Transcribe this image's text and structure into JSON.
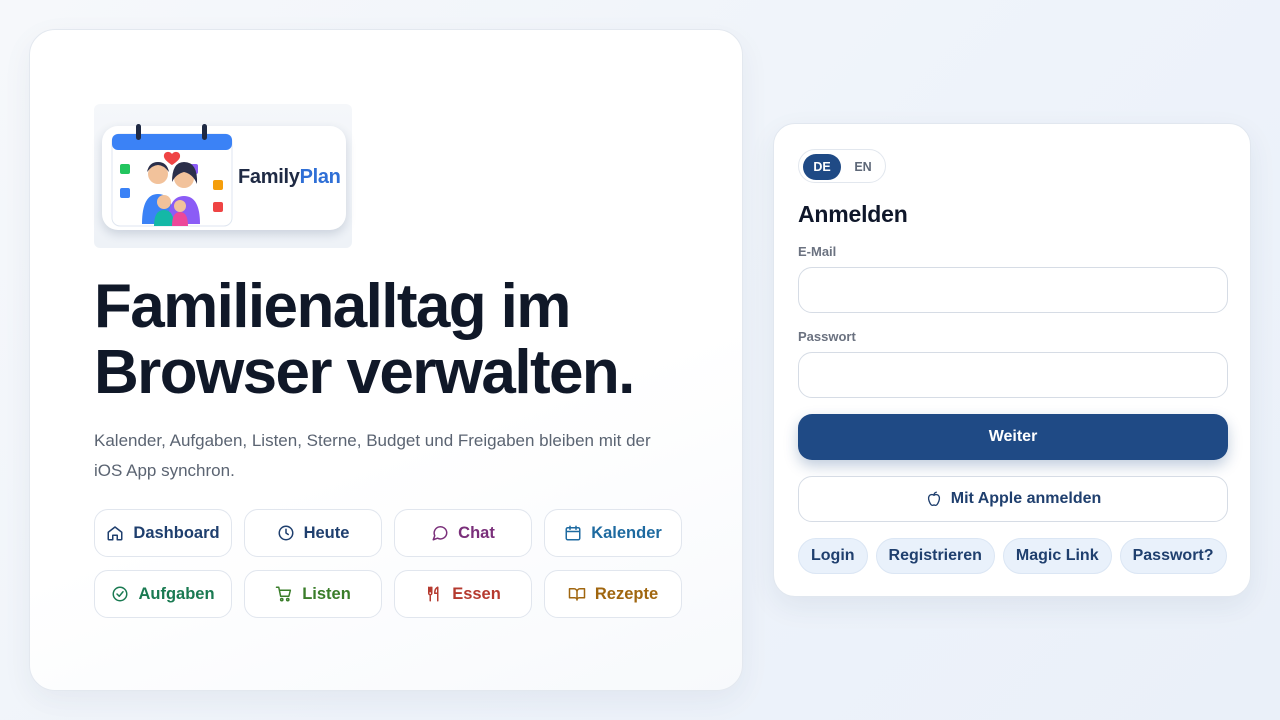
{
  "brand": {
    "name_part1": "Family",
    "name_part2": "Plan"
  },
  "hero": {
    "headline_line1": "Familienalltag im",
    "headline_line2": "Browser verwalten.",
    "subtitle": "Kalender, Aufgaben, Listen, Sterne, Budget und Freigaben bleiben mit der iOS App synchron."
  },
  "features": [
    {
      "label": "Dashboard",
      "icon": "home-icon",
      "color": "#1f3f6e"
    },
    {
      "label": "Heute",
      "icon": "clock-icon",
      "color": "#1f3f6e"
    },
    {
      "label": "Chat",
      "icon": "chat-bubble-icon",
      "color": "#7a2f7a"
    },
    {
      "label": "Kalender",
      "icon": "calendar-icon",
      "color": "#1e6aa0"
    },
    {
      "label": "Aufgaben",
      "icon": "check-circle-icon",
      "color": "#1a7a52"
    },
    {
      "label": "Listen",
      "icon": "cart-icon",
      "color": "#3a7d2a"
    },
    {
      "label": "Essen",
      "icon": "utensils-icon",
      "color": "#b53a2f"
    },
    {
      "label": "Rezepte",
      "icon": "book-icon",
      "color": "#a0660f"
    }
  ],
  "login": {
    "lang_de": "DE",
    "lang_en": "EN",
    "title": "Anmelden",
    "email_label": "E-Mail",
    "email_value": "",
    "password_label": "Passwort",
    "password_value": "",
    "submit_label": "Weiter",
    "apple_label": "Mit Apple anmelden",
    "links": [
      "Login",
      "Registrieren",
      "Magic Link",
      "Passwort?"
    ]
  },
  "colors": {
    "primary": "#1f4a85",
    "headline": "#101828",
    "pill_bg": "#e9f1fb"
  }
}
